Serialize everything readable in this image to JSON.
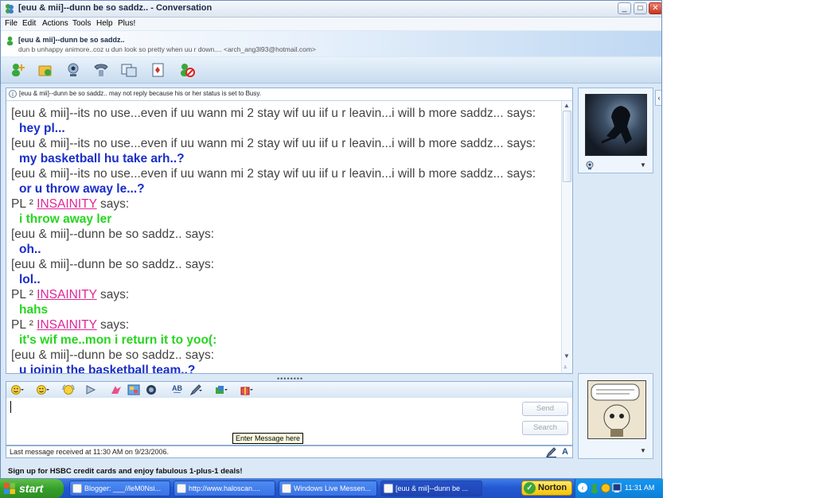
{
  "window": {
    "title": "[euu & mii]--dunn be so saddz.. - Conversation",
    "min_label": "_",
    "max_label": "□",
    "close_label": "✕"
  },
  "menu": [
    "File",
    "Edit",
    "Actions",
    "Tools",
    "Help",
    "Plus!"
  ],
  "contact": {
    "name": "[euu & mii]--dunn be so saddz..",
    "subline": "dun b unhappy animore..coz u dun look so pretty when uu r down.... <arch_ang3l93@hotmail.com>"
  },
  "notice": "[euu & mii]--dunn be so saddz.. may not reply because his or her status is set to Busy.",
  "messages": [
    {
      "sender": "[euu & mii]--its no use...even if uu wann mi 2 stay wif uu iif u r leavin...i will b more saddz...",
      "nick": "",
      "says": " says:",
      "text": "hey pl...",
      "color": "blue"
    },
    {
      "sender": "[euu & mii]--its no use...even if uu wann mi 2 stay wif uu iif u r leavin...i will b more saddz...",
      "nick": "",
      "says": " says:",
      "text": "my basketball hu take arh..?",
      "color": "blue"
    },
    {
      "sender": "[euu & mii]--its no use...even if uu wann mi 2 stay wif uu iif u r leavin...i will b more saddz...",
      "nick": "",
      "says": " says:",
      "text": "or u throw away le...?",
      "color": "blue"
    },
    {
      "sender": "PL ²   ",
      "nick": "INSAINITY",
      "says": " says:",
      "text": "i throw away ler",
      "color": "green"
    },
    {
      "sender": "[euu & mii]--dunn be so saddz..",
      "nick": "",
      "says": " says:",
      "text": "oh..",
      "color": "blue"
    },
    {
      "sender": "[euu & mii]--dunn be so saddz..",
      "nick": "",
      "says": " says:",
      "text": "lol..",
      "color": "blue"
    },
    {
      "sender": "PL ²   ",
      "nick": "INSAINITY",
      "says": " says:",
      "text": "hahs",
      "color": "green"
    },
    {
      "sender": "PL ²   ",
      "nick": "INSAINITY",
      "says": " says:",
      "text": "it's wif me..mon i return it to yoo(:",
      "color": "green"
    },
    {
      "sender": "[euu & mii]--dunn be so saddz..",
      "nick": "",
      "says": " says:",
      "text": "u joinin the basketball team..?",
      "color": "blue"
    }
  ],
  "grip": "••••••••",
  "input": {
    "send_label": "Send",
    "search_label": "Search",
    "tooltip": "Enter Message here"
  },
  "status_bar": {
    "text": "Last message received at 11:30 AM on 9/23/2006.",
    "font_label": "A"
  },
  "ad": "Sign up for HSBC credit cards and enjoy fabulous 1-plus-1 deals!",
  "taskbar": {
    "start_label": "start",
    "tasks": [
      {
        "label": "Blogger: ___//leM0Nsi..."
      },
      {
        "label": "http://www.haloscan...."
      },
      {
        "label": "Windows Live Messen..."
      },
      {
        "label": "[euu & mii]--dunn be ..."
      }
    ],
    "norton_label": "Norton",
    "clock": "11:31 AM"
  },
  "colors": {
    "blue_text": "#1a2ec8",
    "green_text": "#27d51f",
    "nick": "#e0259a",
    "taskbar": "#2459d3"
  }
}
